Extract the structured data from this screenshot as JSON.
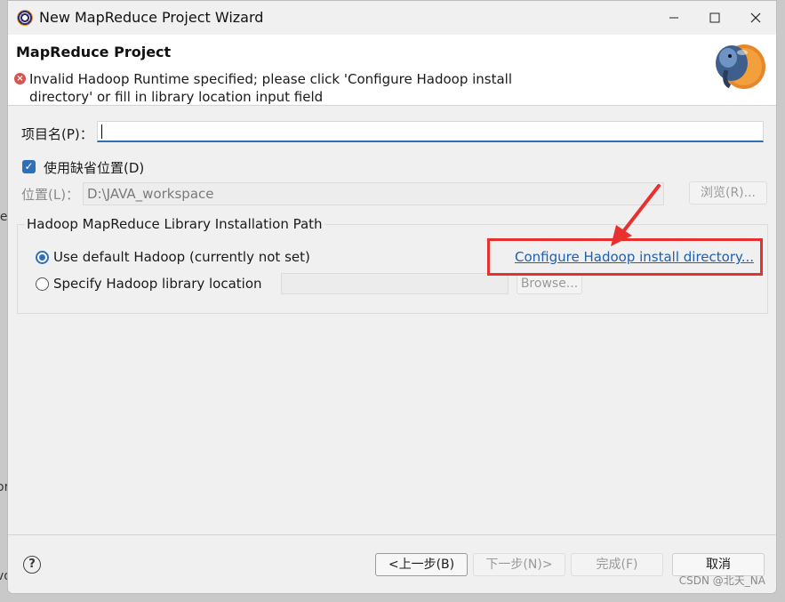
{
  "window": {
    "title": "New MapReduce Project Wizard"
  },
  "header": {
    "title": "MapReduce Project",
    "error_message": "Invalid Hadoop Runtime specified; please click 'Configure Hadoop install directory' or fill in library location input field",
    "error_icon": "error-icon",
    "logo_icon": "hadoop-elephant-icon"
  },
  "form": {
    "project_name_label": "项目名(P)：",
    "project_name_value": "",
    "use_default_location_label": "使用缺省位置(D)",
    "use_default_location_checked": true,
    "location_label": "位置(L)：",
    "location_value": "D:\\JAVA_workspace",
    "browse_label": "浏览(R)..."
  },
  "hadoop_group": {
    "title": "Hadoop MapReduce Library Installation Path",
    "use_default_label": "Use default Hadoop (currently not set)",
    "configure_link": "Configure Hadoop install directory...",
    "specify_label": "Specify Hadoop library location",
    "library_location_value": "",
    "browse_label": "Browse..."
  },
  "footer": {
    "back_label": "<上一步(B)",
    "next_label": "下一步(N)>",
    "finish_label": "完成(F)",
    "cancel_label": "取消",
    "help_icon": "help-icon"
  },
  "watermark": "CSDN @北天_NA",
  "background_fragments": [
    "le",
    "or",
    "vo"
  ],
  "colors": {
    "accent": "#2f6fb7",
    "link": "#1f5fae",
    "annotation": "#e8312f",
    "error": "#d9534f"
  }
}
